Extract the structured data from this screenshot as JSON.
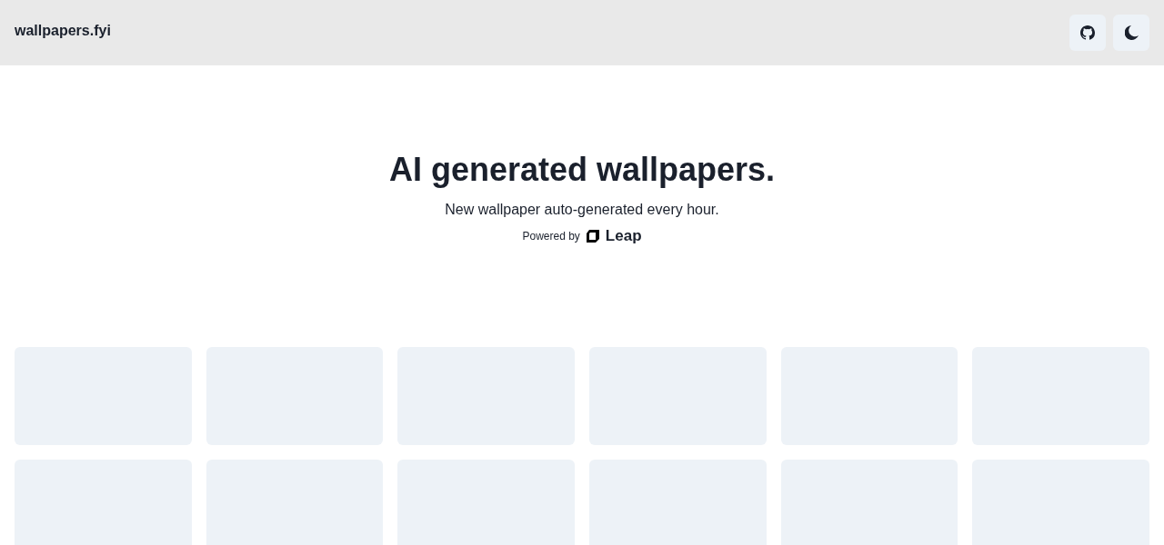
{
  "header": {
    "site_title": "wallpapers.fyi",
    "buttons": [
      {
        "kind": "github"
      },
      {
        "kind": "dark-mode"
      }
    ]
  },
  "hero": {
    "heading": "AI generated wallpapers.",
    "subtitle": "New wallpaper auto-generated every hour.",
    "powered_by": "Powered by",
    "brand": "Leap"
  },
  "gallery": [
    {
      "kind": "placeholder"
    },
    {
      "kind": "placeholder"
    },
    {
      "kind": "placeholder"
    },
    {
      "kind": "placeholder"
    },
    {
      "kind": "placeholder"
    },
    {
      "kind": "placeholder"
    },
    {
      "kind": "placeholder"
    },
    {
      "kind": "placeholder"
    },
    {
      "kind": "placeholder"
    },
    {
      "kind": "placeholder"
    },
    {
      "kind": "placeholder"
    },
    {
      "kind": "placeholder"
    }
  ]
}
